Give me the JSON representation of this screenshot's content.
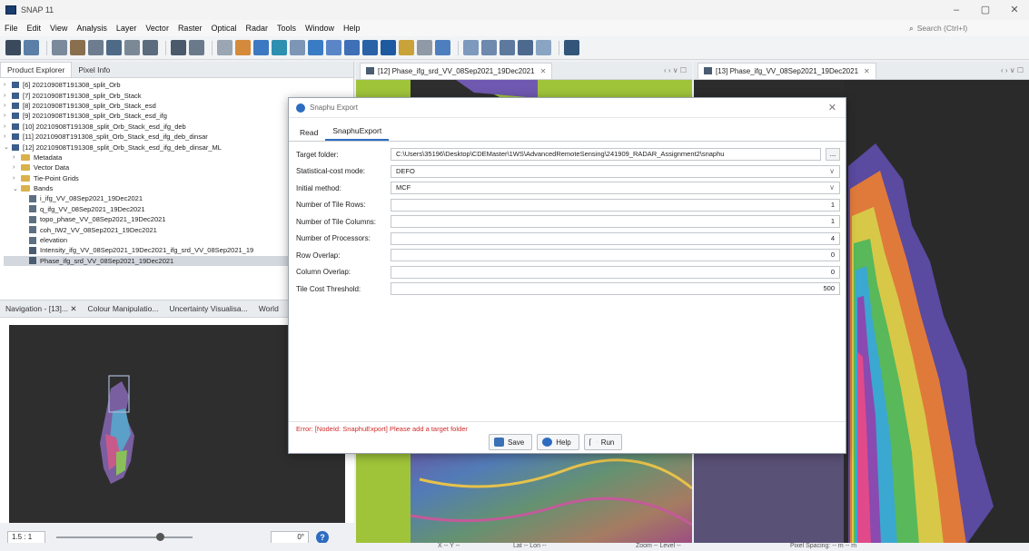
{
  "window": {
    "title": "SNAP 11",
    "controls": [
      "–",
      "▢",
      "✕"
    ]
  },
  "menu": [
    "File",
    "Edit",
    "View",
    "Analysis",
    "Layer",
    "Vector",
    "Raster",
    "Optical",
    "Radar",
    "Tools",
    "Window",
    "Help"
  ],
  "search": {
    "placeholder": "Search (Ctrl+I)"
  },
  "left_tabs": [
    "Product Explorer",
    "Pixel Info"
  ],
  "tree": [
    {
      "label": "[6] 20210908T191308_split_Orb",
      "level": 0
    },
    {
      "label": "[7] 20210908T191308_split_Orb_Stack",
      "level": 0
    },
    {
      "label": "[8] 20210908T191308_split_Orb_Stack_esd",
      "level": 0
    },
    {
      "label": "[9] 20210908T191308_split_Orb_Stack_esd_ifg",
      "level": 0
    },
    {
      "label": "[10] 20210908T191308_split_Orb_Stack_esd_ifg_deb",
      "level": 0
    },
    {
      "label": "[11] 20210908T191308_split_Orb_Stack_esd_ifg_deb_dinsar",
      "level": 0
    },
    {
      "label": "[12] 20210908T191308_split_Orb_Stack_esd_ifg_deb_dinsar_ML",
      "level": 0
    },
    {
      "label": "Metadata",
      "level": 1
    },
    {
      "label": "Vector Data",
      "level": 1
    },
    {
      "label": "Tie-Point Grids",
      "level": 1
    },
    {
      "label": "Bands",
      "level": 1
    },
    {
      "label": "i_ifg_VV_08Sep2021_19Dec2021",
      "level": 2
    },
    {
      "label": "q_ifg_VV_08Sep2021_19Dec2021",
      "level": 2
    },
    {
      "label": "topo_phase_VV_08Sep2021_19Dec2021",
      "level": 2
    },
    {
      "label": "coh_IW2_VV_08Sep2021_19Dec2021",
      "level": 2
    },
    {
      "label": "elevation",
      "level": 2
    },
    {
      "label": "Intensity_ifg_VV_08Sep2021_19Dec2021_ifg_srd_VV_08Sep2021_19",
      "level": 2
    },
    {
      "label": "Phase_ifg_srd_VV_08Sep2021_19Dec2021",
      "level": 2
    }
  ],
  "nav_tabs": [
    "Navigation - [13]...",
    "Colour Manipulatio...",
    "Uncertainty Visualisa...",
    "World"
  ],
  "nav": {
    "zoom": "1.5 : 1",
    "angle": "0°",
    "help_glyph": "?"
  },
  "views": [
    {
      "tab": "[12] Phase_ifg_srd_VV_08Sep2021_19Dec2021"
    },
    {
      "tab": "[13] Phase_ifg_VV_08Sep2021_19Dec2021"
    }
  ],
  "view_ctrls": "‹ › ∨ ☐",
  "status": {
    "x": "X  -- Y --",
    "lat": "Lat  -- Lon  --",
    "zoom": "Zoom -- Level --",
    "spacing": "Pixel Spacing: -- m -- m"
  },
  "dialog": {
    "title": "Snaphu Export",
    "tabs": [
      "Read",
      "SnaphuExport"
    ],
    "fields": {
      "target_folder": {
        "label": "Target folder:",
        "value": "C:\\Users\\35196\\Desktop\\CDEMaster\\1WS\\AdvancedRemoteSensing\\241909_RADAR_Assignment2\\snaphu",
        "browse": "..."
      },
      "cost_mode": {
        "label": "Statistical-cost mode:",
        "value": "DEFO"
      },
      "init_method": {
        "label": "Initial method:",
        "value": "MCF"
      },
      "tile_rows": {
        "label": "Number of Tile Rows:",
        "value": "1"
      },
      "tile_cols": {
        "label": "Number of Tile Columns:",
        "value": "1"
      },
      "processors": {
        "label": "Number of Processors:",
        "value": "4"
      },
      "row_overlap": {
        "label": "Row Overlap:",
        "value": "0"
      },
      "col_overlap": {
        "label": "Column Overlap:",
        "value": "0"
      },
      "tile_cost": {
        "label": "Tile Cost Threshold:",
        "value": "500"
      }
    },
    "error": "Error: [NodeId: SnaphuExport] Please add a target folder",
    "buttons": {
      "save": "Save",
      "help": "Help",
      "run": "Run"
    }
  }
}
